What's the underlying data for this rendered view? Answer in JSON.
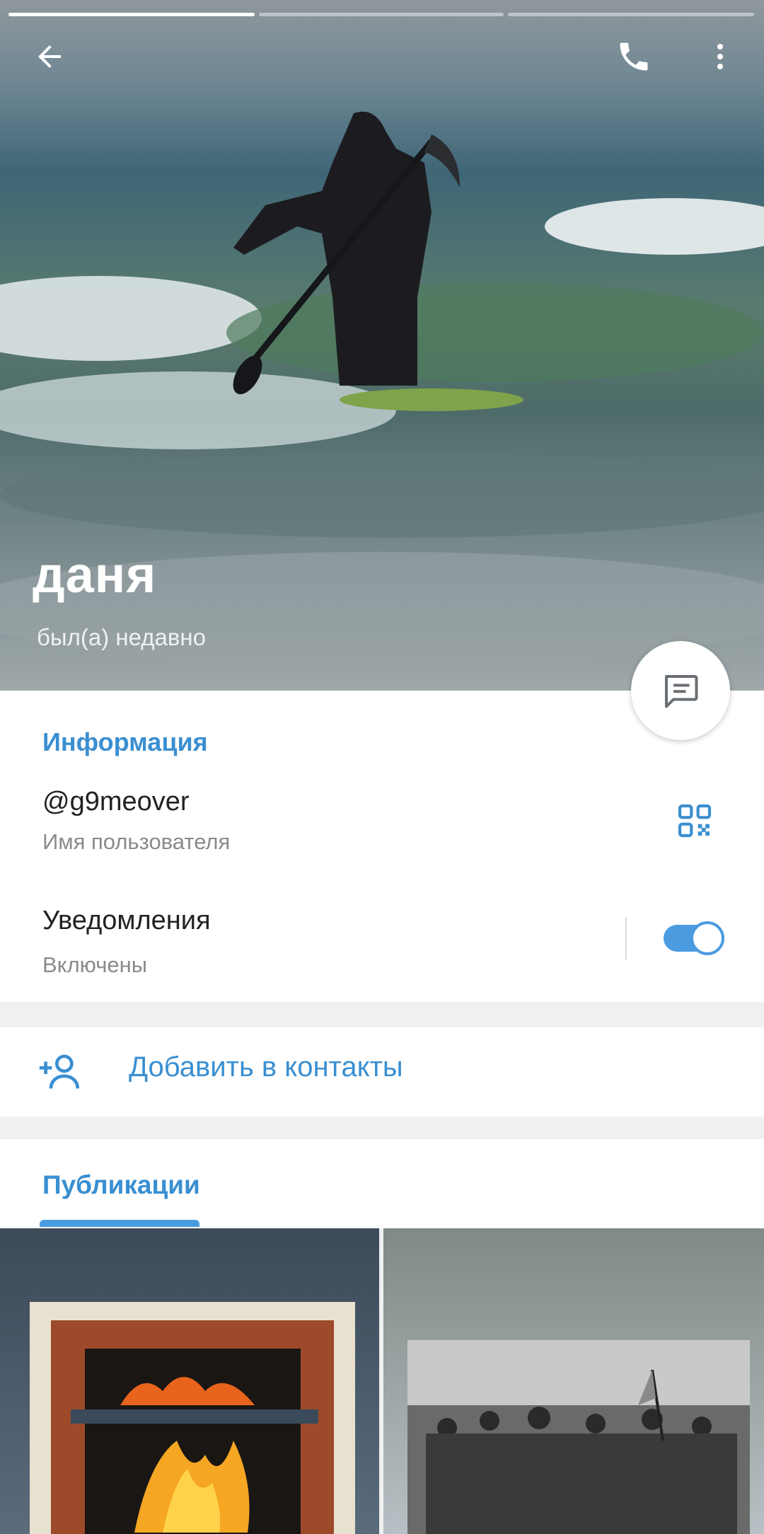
{
  "profile": {
    "name": "даня",
    "status": "был(а) недавно"
  },
  "icons": {
    "back": "arrow-left-icon",
    "call": "phone-icon",
    "menu": "more-vert-icon",
    "message": "chat-message-icon",
    "qr": "qr-code-icon",
    "add_contact": "add-user-icon"
  },
  "info": {
    "title": "Информация",
    "username": "@g9meover",
    "username_label": "Имя пользователя",
    "notifications": "Уведомления",
    "notifications_status": "Включены",
    "notifications_enabled": true
  },
  "actions": {
    "add_contact": "Добавить в контакты"
  },
  "media": {
    "tab": "Публикации"
  },
  "colors": {
    "accent": "#3a8fd1",
    "toggle": "#4b9be0"
  },
  "story_progress": {
    "segments": 3,
    "active_index": 0
  }
}
